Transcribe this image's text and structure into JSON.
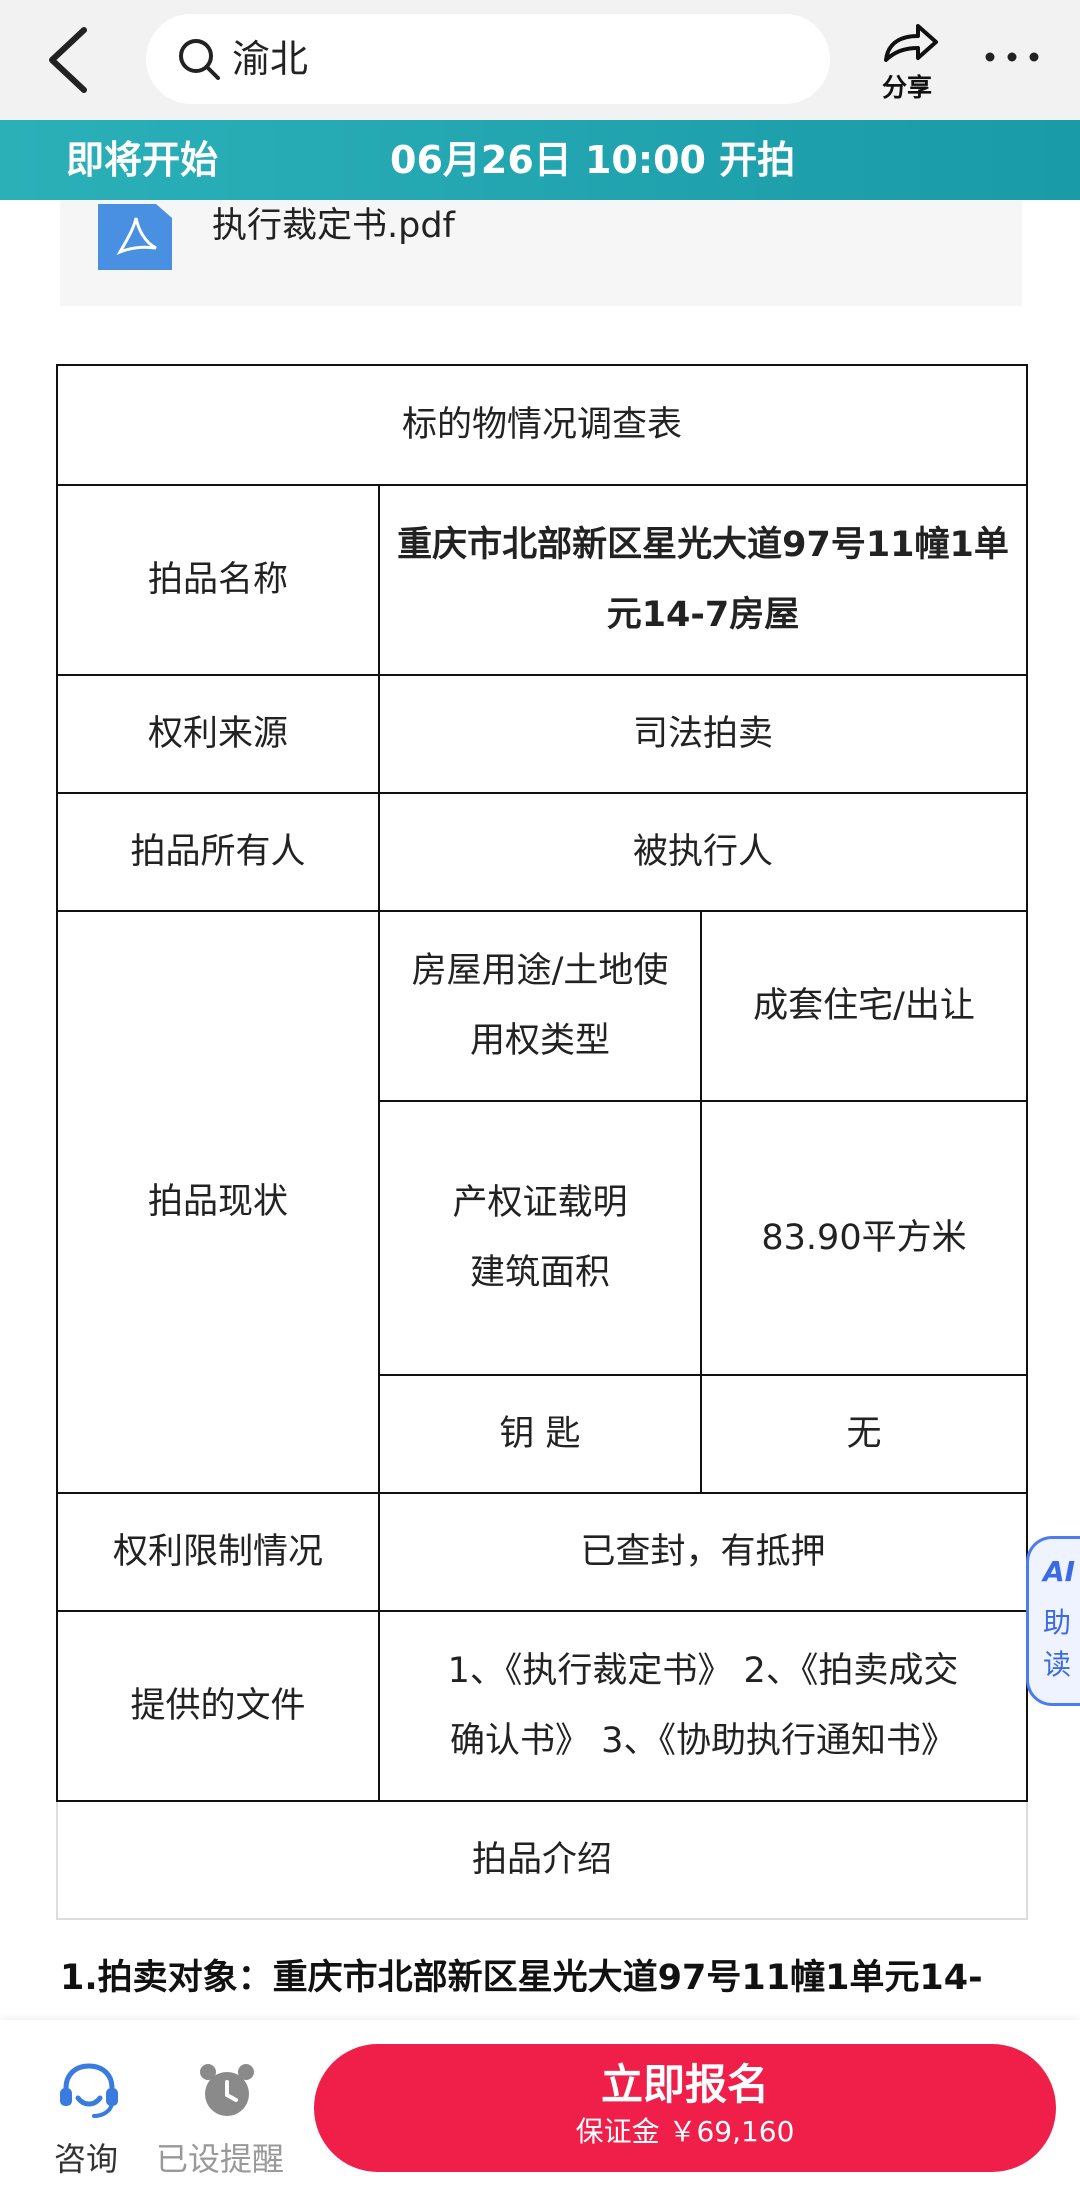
{
  "header": {
    "search_text": "渝北",
    "share_label": "分享"
  },
  "banner": {
    "status": "即将开始",
    "start_time": "06月26日 10:00 开拍"
  },
  "attachment": {
    "filename": "执行裁定书.pdf"
  },
  "table": {
    "title": "标的物情况调查表",
    "rows": {
      "name_label": "拍品名称",
      "name_value_line1": "重庆市北部新区星光大道97号11幢1单",
      "name_value_line2": "元14-7房屋",
      "source_label": "权利来源",
      "source_value": "司法拍卖",
      "owner_label": "拍品所有人",
      "owner_value": "被执行人",
      "status_label": "拍品现状",
      "usage_label_line1": "房屋用途/土地使",
      "usage_label_line2": "用权类型",
      "usage_value": "成套住宅/出让",
      "area_label_line1": "产权证载明",
      "area_label_line2": "建筑面积",
      "area_value": "83.90平方米",
      "key_label": "钥 匙",
      "key_value": "无",
      "restriction_label": "权利限制情况",
      "restriction_value": "已查封，有抵押",
      "docs_label": "提供的文件",
      "docs_value_line1": "1、《执行裁定书》 2、《拍卖成交",
      "docs_value_line2": "确认书》 3、《协助执行通知书》"
    },
    "intro_heading": "拍品介绍"
  },
  "intro_text": "1.拍卖对象：重庆市北部新区星光大道97号11幢1单元14-",
  "ai_reader": {
    "line1": "AI",
    "line2": "助",
    "line3": "读"
  },
  "bottom": {
    "consult_label": "咨询",
    "remind_label": "已设提醒",
    "signup_label": "立即报名",
    "deposit_label": "保证金 ￥69,160"
  },
  "colors": {
    "banner": "#1fa6b0",
    "signup": "#ef1f49",
    "ai_accent": "#4c7df0",
    "consult_icon": "#3a7be0"
  }
}
